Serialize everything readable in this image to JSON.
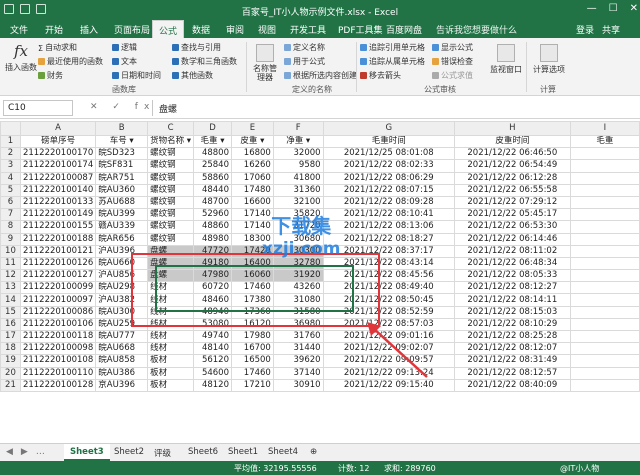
{
  "window": {
    "title": "百家号_IT小人物示例文件.xlsx - Excel"
  },
  "tabs": [
    "文件",
    "开始",
    "插入",
    "页面布局",
    "公式",
    "数据",
    "审阅",
    "视图",
    "开发工具",
    "PDF工具集",
    "百度网盘"
  ],
  "active_tab": "公式",
  "tell_me": "告诉我您想要做什么",
  "login": "登录",
  "share": "共享",
  "ribbon": {
    "insert_function": "插入函数",
    "autosum": "自动求和",
    "recent": "最近使用的函数",
    "financial": "财务",
    "logical": "逻辑",
    "text": "文本",
    "datetime": "日期和时间",
    "lookup": "查找与引用",
    "math": "数学和三角函数",
    "more": "其他函数",
    "group_library": "函数库",
    "name_manager": "名称管理器",
    "define_name": "定义名称",
    "use_in_formula": "用于公式",
    "create_from_sel": "根据所选内容创建",
    "group_names": "定义的名称",
    "trace_prec": "追踪引用单元格",
    "trace_dep": "追踪从属单元格",
    "remove_arrows": "移去箭头",
    "show_formulas": "显示公式",
    "error_check": "错误检查",
    "evaluate": "公式求值",
    "group_audit": "公式审核",
    "watch": "监视窗口",
    "calc_options": "计算选项",
    "group_calc": "计算"
  },
  "formula_bar": {
    "namebox": "C10",
    "fx": "✕ ✓ fx",
    "value": "盘螺"
  },
  "columns": [
    "A",
    "B",
    "C",
    "D",
    "E",
    "F",
    "G",
    "H",
    "I"
  ],
  "headers": [
    "磅单序号",
    "车号",
    "货物名称",
    "毛重",
    "皮重",
    "净重",
    "毛重时间",
    "皮重时间",
    "毛重"
  ],
  "rows": [
    [
      "2112220100170",
      "皖SD323",
      "螺纹钢",
      "48800",
      "16800",
      "32000",
      "2021/12/25 08:01:08",
      "2021/12/22 06:46:50"
    ],
    [
      "2112220100174",
      "皖SF831",
      "螺纹钢",
      "25840",
      "16260",
      "9580",
      "2021/12/22 08:02:33",
      "2021/12/22 06:54:49"
    ],
    [
      "2112220100087",
      "皖AR751",
      "螺纹钢",
      "58860",
      "17060",
      "41800",
      "2021/12/22 08:06:29",
      "2021/12/22 06:12:28"
    ],
    [
      "2112220100140",
      "皖AU360",
      "螺纹钢",
      "48440",
      "17480",
      "31360",
      "2021/12/22 08:07:15",
      "2021/12/22 06:55:58"
    ],
    [
      "2112220100133",
      "苏AU688",
      "螺纹钢",
      "48700",
      "16600",
      "32100",
      "2021/12/22 08:09:28",
      "2021/12/22 07:29:12"
    ],
    [
      "2112220100149",
      "皖AU399",
      "螺纹钢",
      "52960",
      "17140",
      "35820",
      "2021/12/22 08:10:41",
      "2021/12/22 05:45:17"
    ],
    [
      "2112220100155",
      "赣AU339",
      "螺纹钢",
      "48860",
      "17140",
      "31720",
      "2021/12/22 08:13:06",
      "2021/12/22 06:53:30"
    ],
    [
      "2112220100188",
      "皖AR656",
      "螺纹钢",
      "48980",
      "18300",
      "30680",
      "2021/12/22 08:18:27",
      "2021/12/22 06:14:46"
    ],
    [
      "2112220100121",
      "沪AU396",
      "盘螺",
      "47720",
      "17420",
      "30300",
      "2021/12/22 08:37:17",
      "2021/12/22 08:11:02"
    ],
    [
      "2112220100126",
      "皖AU660",
      "盘螺",
      "49180",
      "16400",
      "32780",
      "2021/12/22 08:43:14",
      "2021/12/22 06:48:34"
    ],
    [
      "2112220100127",
      "沪AU856",
      "盘螺",
      "47980",
      "16060",
      "31920",
      "2021/12/22 08:45:56",
      "2021/12/22 08:05:33"
    ],
    [
      "2112220100099",
      "皖AU298",
      "线材",
      "60720",
      "17460",
      "43260",
      "2021/12/22 08:49:40",
      "2021/12/22 08:12:27"
    ],
    [
      "2112220100097",
      "沪AU382",
      "线材",
      "48460",
      "17380",
      "31080",
      "2021/12/22 08:50:45",
      "2021/12/22 08:14:11"
    ],
    [
      "2112220100086",
      "皖AU300",
      "线材",
      "48940",
      "17360",
      "31580",
      "2021/12/22 08:52:59",
      "2021/12/22 08:15:03"
    ],
    [
      "2112220100106",
      "皖AU259",
      "线材",
      "53080",
      "16120",
      "36980",
      "2021/12/22 08:57:03",
      "2021/12/22 08:10:29"
    ],
    [
      "2112220100118",
      "皖AU777",
      "线材",
      "49740",
      "17980",
      "31760",
      "2021/12/22 09:01:16",
      "2021/12/22 08:25:28"
    ],
    [
      "2112220100098",
      "皖AU668",
      "线材",
      "48140",
      "16700",
      "31440",
      "2021/12/22 09:02:07",
      "2021/12/22 08:12:07"
    ],
    [
      "2112220100108",
      "皖AU858",
      "板材",
      "56120",
      "16500",
      "39620",
      "2021/12/22 09:09:57",
      "2021/12/22 08:31:49"
    ],
    [
      "2112220100110",
      "皖AU386",
      "板材",
      "54600",
      "17460",
      "37140",
      "2021/12/22 09:13:24",
      "2021/12/22 08:12:57"
    ],
    [
      "2112220100128",
      "京AU396",
      "板材",
      "48120",
      "17210",
      "30910",
      "2021/12/22 09:15:40",
      "2021/12/22 08:40:09"
    ]
  ],
  "sheets": [
    "Sheet3",
    "Sheet2",
    "评级",
    "Sheet6",
    "Sheet1",
    "Sheet4"
  ],
  "active_sheet": "Sheet3",
  "status": {
    "avg": "平均值: 32195.55556",
    "count": "计数: 12",
    "sum": "求和: 289760"
  },
  "watermark": {
    "brand": "下载集",
    "url": "xzji.com"
  },
  "credit": "@IT小人物"
}
